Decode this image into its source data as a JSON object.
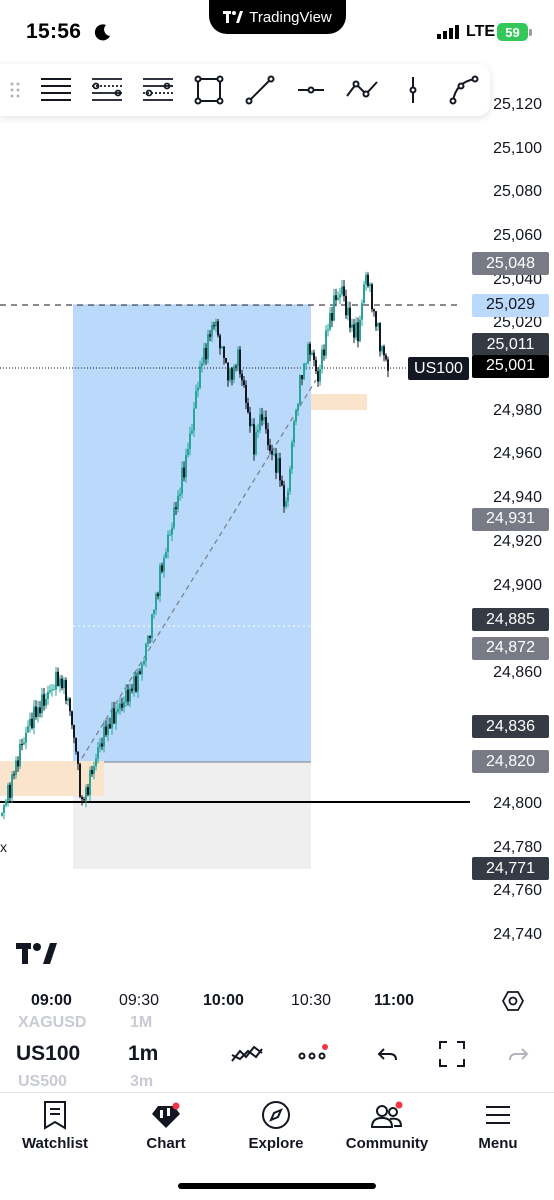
{
  "status_bar": {
    "time": "15:56",
    "network": "LTE",
    "battery": "59",
    "app_pill": "TradingView"
  },
  "drawing_toolbar": {
    "tools": [
      "horizontal-lines-icon",
      "fib-retracement-icon",
      "parallel-channel-icon",
      "rectangle-icon",
      "trend-line-icon",
      "horizontal-line-icon",
      "path-icon",
      "vertical-line-icon",
      "curve-icon"
    ]
  },
  "chart": {
    "price_axis": [
      "25,120",
      "25,100",
      "25,080",
      "25,060",
      "25,040",
      "25,020",
      "24,980",
      "24,960",
      "24,940",
      "24,920",
      "24,900",
      "24,860",
      "24,800",
      "24,780",
      "24,760",
      "24,740"
    ],
    "price_tags": [
      {
        "label": "25,048",
        "color": "#787b86"
      },
      {
        "label": "25,029",
        "color": "#bbd9fb",
        "text_color": "#131722"
      },
      {
        "label": "25,011",
        "color": "#363a45"
      },
      {
        "label": "25,001",
        "color": "#000000"
      },
      {
        "label": "24,931",
        "color": "#787b86"
      },
      {
        "label": "24,885",
        "color": "#363a45"
      },
      {
        "label": "24,872",
        "color": "#787b86"
      },
      {
        "label": "24,836",
        "color": "#363a45"
      },
      {
        "label": "24,820",
        "color": "#787b86"
      },
      {
        "label": "24,771",
        "color": "#363a45"
      }
    ],
    "symbol_tag": "US100",
    "colors": {
      "candle_up": "#26a69a",
      "candle_down": "#131722",
      "profit_zone": "#bbd9fb",
      "stop_zone": "#efefef",
      "demand_zone": "#fbe4cc"
    },
    "corner_mark": "x"
  },
  "time_axis": {
    "labels": [
      "09:00",
      "09:30",
      "10:00",
      "10:30",
      "11:00"
    ]
  },
  "symbol_strip": {
    "symbol": "US100",
    "interval": "1m",
    "prev_symbol": "XAGUSD",
    "prev_interval": "1M",
    "next_symbol": "US500",
    "next_interval": "3m"
  },
  "tab_bar": {
    "tabs": [
      "Watchlist",
      "Chart",
      "Explore",
      "Community",
      "Menu"
    ]
  }
}
